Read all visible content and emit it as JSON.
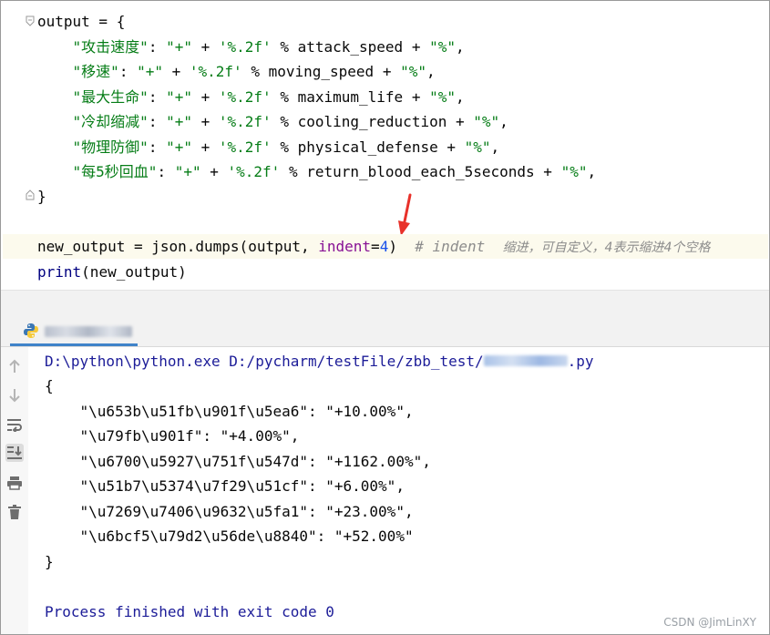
{
  "editor": {
    "lines": [
      {
        "segments": [
          {
            "t": "output = {",
            "c": "k"
          }
        ]
      },
      {
        "segments": [
          {
            "t": "    ",
            "c": "k"
          },
          {
            "t": "\"攻击速度\"",
            "c": "s"
          },
          {
            "t": ": ",
            "c": "k"
          },
          {
            "t": "\"+\"",
            "c": "s"
          },
          {
            "t": " + ",
            "c": "k"
          },
          {
            "t": "'%.2f'",
            "c": "s"
          },
          {
            "t": " % attack_speed + ",
            "c": "k"
          },
          {
            "t": "\"%\"",
            "c": "s"
          },
          {
            "t": ",",
            "c": "k"
          }
        ]
      },
      {
        "segments": [
          {
            "t": "    ",
            "c": "k"
          },
          {
            "t": "\"移速\"",
            "c": "s"
          },
          {
            "t": ": ",
            "c": "k"
          },
          {
            "t": "\"+\"",
            "c": "s"
          },
          {
            "t": " + ",
            "c": "k"
          },
          {
            "t": "'%.2f'",
            "c": "s"
          },
          {
            "t": " % moving_speed + ",
            "c": "k"
          },
          {
            "t": "\"%\"",
            "c": "s"
          },
          {
            "t": ",",
            "c": "k"
          }
        ]
      },
      {
        "segments": [
          {
            "t": "    ",
            "c": "k"
          },
          {
            "t": "\"最大生命\"",
            "c": "s"
          },
          {
            "t": ": ",
            "c": "k"
          },
          {
            "t": "\"+\"",
            "c": "s"
          },
          {
            "t": " + ",
            "c": "k"
          },
          {
            "t": "'%.2f'",
            "c": "s"
          },
          {
            "t": " % maximum_life + ",
            "c": "k"
          },
          {
            "t": "\"%\"",
            "c": "s"
          },
          {
            "t": ",",
            "c": "k"
          }
        ]
      },
      {
        "segments": [
          {
            "t": "    ",
            "c": "k"
          },
          {
            "t": "\"冷却缩减\"",
            "c": "s"
          },
          {
            "t": ": ",
            "c": "k"
          },
          {
            "t": "\"+\"",
            "c": "s"
          },
          {
            "t": " + ",
            "c": "k"
          },
          {
            "t": "'%.2f'",
            "c": "s"
          },
          {
            "t": " % cooling_reduction + ",
            "c": "k"
          },
          {
            "t": "\"%\"",
            "c": "s"
          },
          {
            "t": ",",
            "c": "k"
          }
        ]
      },
      {
        "segments": [
          {
            "t": "    ",
            "c": "k"
          },
          {
            "t": "\"物理防御\"",
            "c": "s"
          },
          {
            "t": ": ",
            "c": "k"
          },
          {
            "t": "\"+\"",
            "c": "s"
          },
          {
            "t": " + ",
            "c": "k"
          },
          {
            "t": "'%.2f'",
            "c": "s"
          },
          {
            "t": " % physical_defense + ",
            "c": "k"
          },
          {
            "t": "\"%\"",
            "c": "s"
          },
          {
            "t": ",",
            "c": "k"
          }
        ]
      },
      {
        "segments": [
          {
            "t": "    ",
            "c": "k"
          },
          {
            "t": "\"每5秒回血\"",
            "c": "s"
          },
          {
            "t": ": ",
            "c": "k"
          },
          {
            "t": "\"+\"",
            "c": "s"
          },
          {
            "t": " + ",
            "c": "k"
          },
          {
            "t": "'%.2f'",
            "c": "s"
          },
          {
            "t": " % return_blood_each_5seconds + ",
            "c": "k"
          },
          {
            "t": "\"%\"",
            "c": "s"
          },
          {
            "t": ",",
            "c": "k"
          }
        ]
      },
      {
        "segments": [
          {
            "t": "}",
            "c": "k"
          }
        ]
      },
      {
        "segments": []
      },
      {
        "segments": [
          {
            "t": "new_output = json.dumps(output, ",
            "c": "k"
          },
          {
            "t": "indent",
            "c": "p"
          },
          {
            "t": "=",
            "c": "k"
          },
          {
            "t": "4",
            "c": "n"
          },
          {
            "t": ")  ",
            "c": "k"
          },
          {
            "t": "# indent  ",
            "c": "c"
          },
          {
            "t": "缩进，可自定义，4表示缩进4个空格",
            "c": "cz"
          }
        ]
      },
      {
        "segments": [
          {
            "t": "print",
            "c": "fn"
          },
          {
            "t": "(new_output)",
            "c": "k"
          }
        ]
      }
    ]
  },
  "run": {
    "tab_label": "",
    "command_prefix": "D:\\python\\python.exe D:/pycharm/testFile/zbb_test/",
    "command_suffix": ".py",
    "output": [
      "{",
      "    \"\\u653b\\u51fb\\u901f\\u5ea6\": \"+10.00%\",",
      "    \"\\u79fb\\u901f\": \"+4.00%\",",
      "    \"\\u6700\\u5927\\u751f\\u547d\": \"+1162.00%\",",
      "    \"\\u51b7\\u5374\\u7f29\\u51cf\": \"+6.00%\",",
      "    \"\\u7269\\u7406\\u9632\\u5fa1\": \"+23.00%\",",
      "    \"\\u6bcf5\\u79d2\\u56de\\u8840\": \"+52.00%\"",
      "}"
    ],
    "exit_message": "Process finished with exit code 0"
  },
  "watermark": "CSDN @JimLinXY",
  "colors": {
    "string": "#067d17",
    "param": "#871094",
    "number": "#1750eb",
    "comment": "#8c8c8c",
    "console_path": "#1c1c98",
    "arrow": "#e8312a"
  }
}
